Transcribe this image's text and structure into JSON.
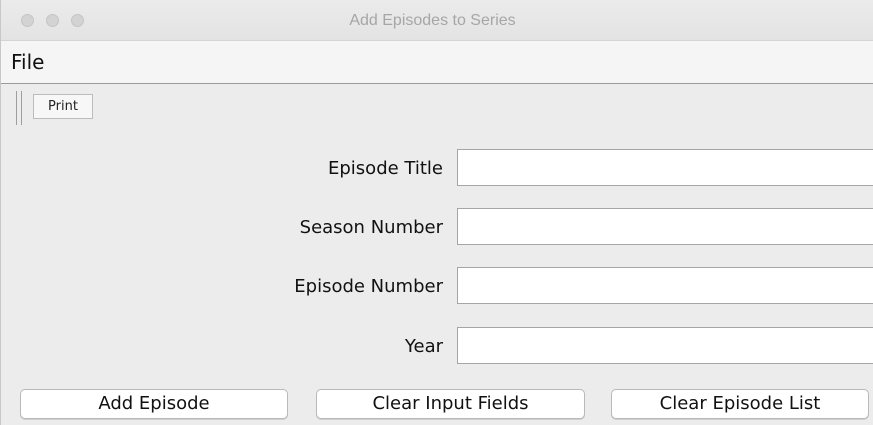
{
  "window": {
    "title": "Add Episodes to Series"
  },
  "menubar": {
    "file_label": "File"
  },
  "toolbar": {
    "print_label": "Print"
  },
  "form": {
    "fields": [
      {
        "label": "Episode Title",
        "value": "",
        "placeholder": ""
      },
      {
        "label": "Season Number",
        "value": "",
        "placeholder": ""
      },
      {
        "label": "Episode Number",
        "value": "",
        "placeholder": ""
      },
      {
        "label": "Year",
        "value": "",
        "placeholder": ""
      }
    ]
  },
  "actions": {
    "add_episode_label": "Add Episode",
    "clear_inputs_label": "Clear Input Fields",
    "clear_list_label": "Clear Episode List"
  },
  "colors": {
    "window_bg": "#ececec",
    "title_text": "#a6a6a6",
    "traffic_light_inactive": "#d3d3d3"
  }
}
